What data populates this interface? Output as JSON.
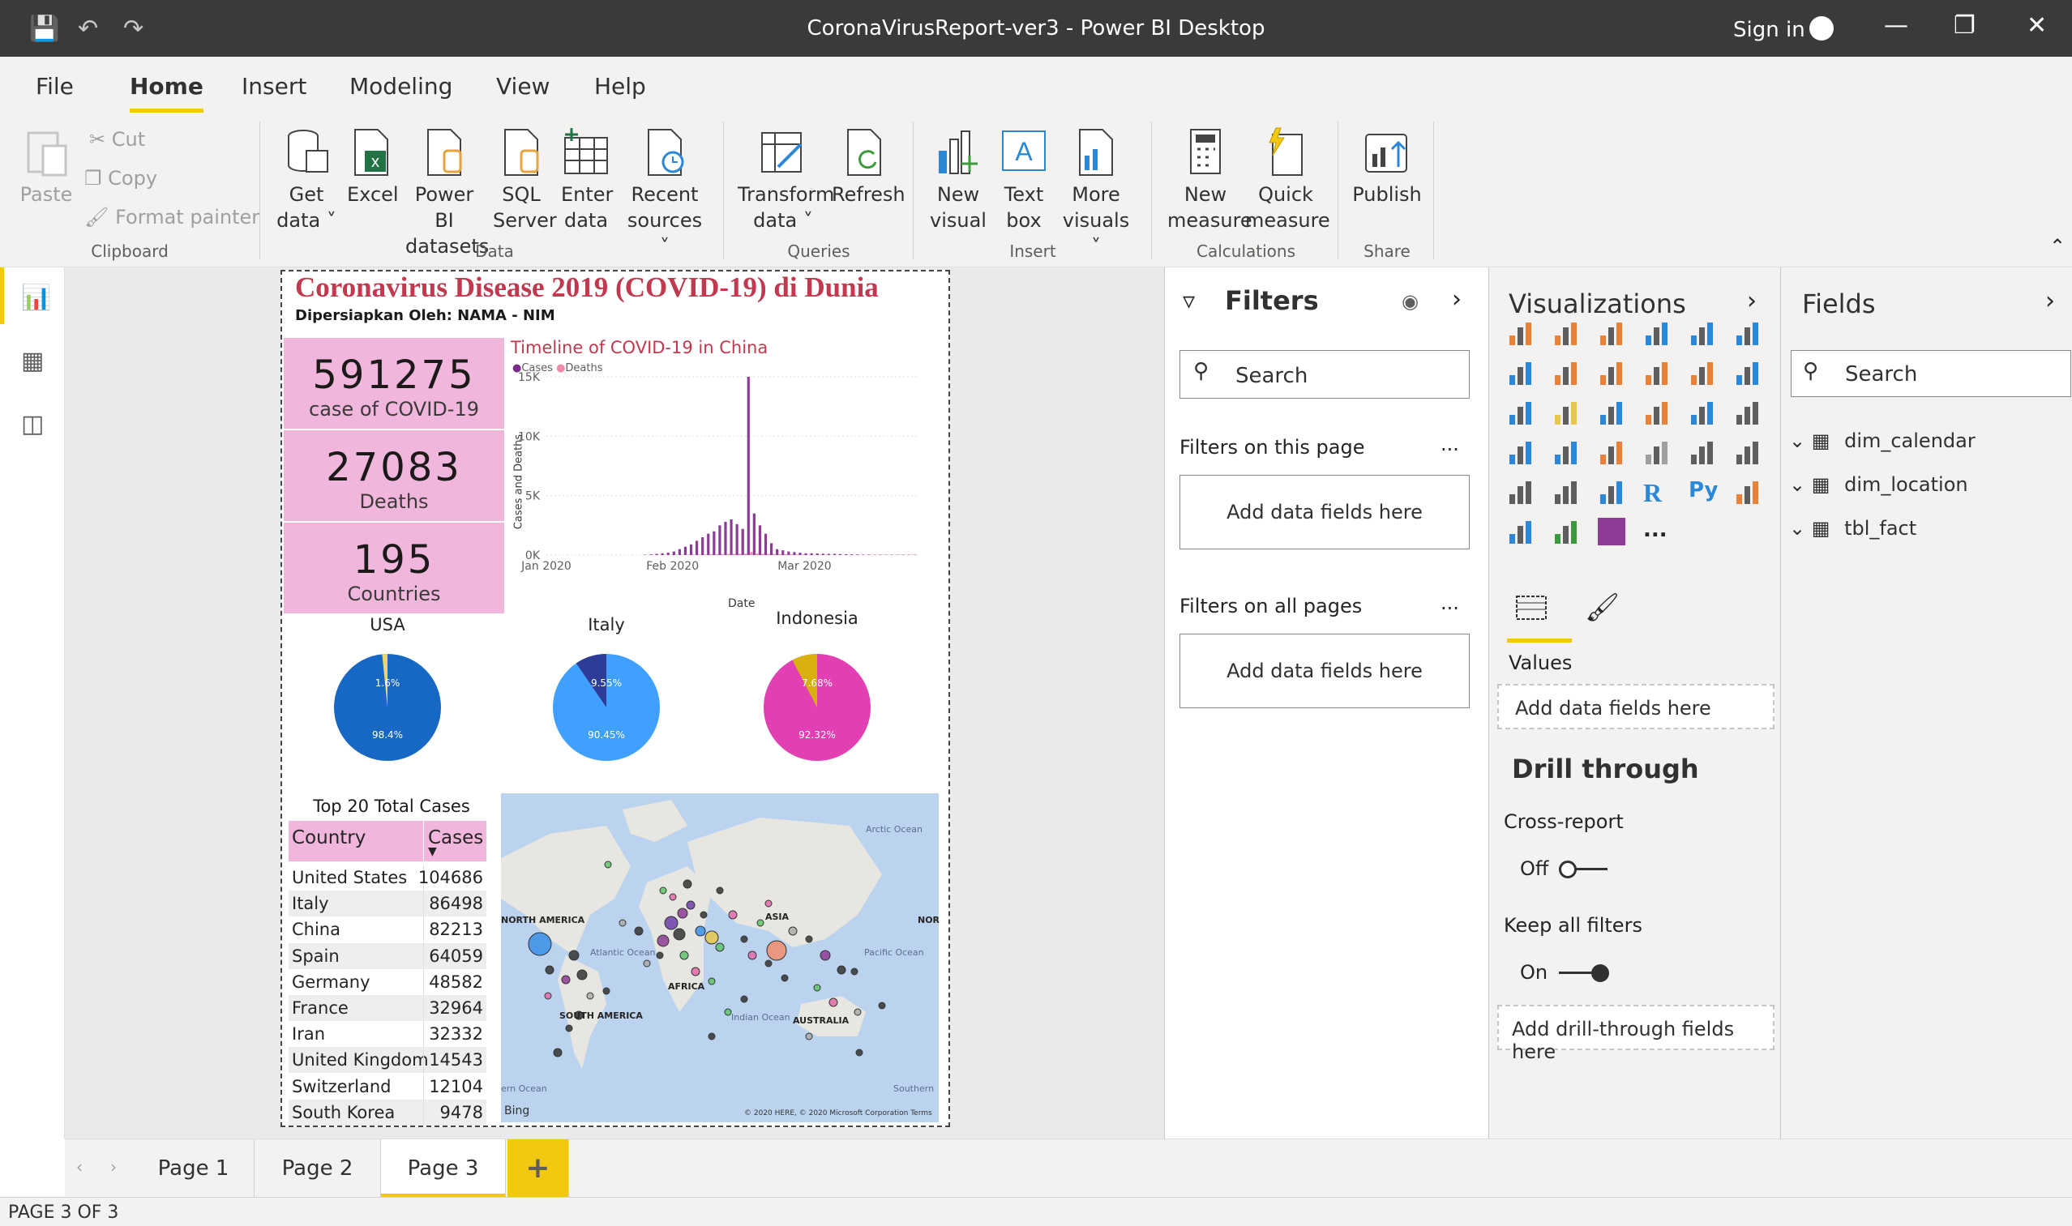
{
  "app": {
    "title": "CoronaVirusReport-ver3 - Power BI Desktop",
    "sign_in": "Sign in"
  },
  "menu": {
    "tabs": [
      "File",
      "Home",
      "Insert",
      "Modeling",
      "View",
      "Help"
    ]
  },
  "ribbon": {
    "clipboard": {
      "paste": "Paste",
      "cut": "Cut",
      "copy": "Copy",
      "format_painter": "Format painter",
      "group": "Clipboard"
    },
    "data": {
      "get_data_1": "Get",
      "get_data_2": "data",
      "excel": "Excel",
      "pbi_1": "Power BI",
      "pbi_2": "datasets",
      "sql_1": "SQL",
      "sql_2": "Server",
      "enter_1": "Enter",
      "enter_2": "data",
      "recent_1": "Recent",
      "recent_2": "sources",
      "group": "Data"
    },
    "queries": {
      "transform_1": "Transform",
      "transform_2": "data",
      "refresh": "Refresh",
      "group": "Queries"
    },
    "insert": {
      "new_visual_1": "New",
      "new_visual_2": "visual",
      "text_box_1": "Text",
      "text_box_2": "box",
      "more_1": "More",
      "more_2": "visuals",
      "group": "Insert"
    },
    "calculations": {
      "new_measure_1": "New",
      "new_measure_2": "measure",
      "quick_1": "Quick",
      "quick_2": "measure",
      "group": "Calculations"
    },
    "share": {
      "publish": "Publish",
      "group": "Share"
    }
  },
  "report": {
    "title": "Coronavirus Disease 2019 (COVID-19) di Dunia",
    "subtitle": "Dipersiapkan Oleh: NAMA - NIM",
    "kpis": [
      {
        "value": "591275",
        "label": "case of COVID-19"
      },
      {
        "value": "27083",
        "label": "Deaths"
      },
      {
        "value": "195",
        "label": "Countries"
      }
    ],
    "timeline": {
      "title": "Timeline of COVID-19 in China",
      "legend_cases": "Cases",
      "legend_deaths": "Deaths",
      "ylabel": "Cases and Deaths",
      "xlabel": "Date",
      "yticks": [
        "15K",
        "10K",
        "5K",
        "0K"
      ],
      "xticks": [
        "Jan 2020",
        "Feb 2020",
        "Mar 2020"
      ]
    },
    "pies": [
      {
        "name": "USA",
        "a": "1.6%",
        "b": "98.4%",
        "share": 1.6,
        "color_main": "#1767c4",
        "color_slice": "#e8d86a"
      },
      {
        "name": "Italy",
        "a": "9.55%",
        "b": "90.45%",
        "share": 9.55,
        "color_main": "#3fa0ff",
        "color_slice": "#2f3c97"
      },
      {
        "name": "Indonesia",
        "a": "7.68%",
        "b": "92.32%",
        "share": 7.68,
        "color_main": "#e13fb2",
        "color_slice": "#d9b00f"
      }
    ],
    "table": {
      "title": "Top 20 Total Cases",
      "col1": "Country",
      "col2": "Cases",
      "rows": [
        [
          "United States",
          "104686"
        ],
        [
          "Italy",
          "86498"
        ],
        [
          "China",
          "82213"
        ],
        [
          "Spain",
          "64059"
        ],
        [
          "Germany",
          "48582"
        ],
        [
          "France",
          "32964"
        ],
        [
          "Iran",
          "32332"
        ],
        [
          "United Kingdom",
          "14543"
        ],
        [
          "Switzerland",
          "12104"
        ],
        [
          "South Korea",
          "9478"
        ]
      ]
    },
    "map": {
      "labels": [
        "NORTH AMERICA",
        "SOUTH AMERICA",
        "AFRICA",
        "ASIA",
        "AUSTRALIA",
        "Atlantic Ocean",
        "Pacific Ocean",
        "Indian Ocean",
        "Arctic Ocean",
        "Southern",
        "ern Ocean",
        "NOR"
      ],
      "brand": "Bing",
      "copyright": "© 2020 HERE, © 2020 Microsoft Corporation Terms"
    }
  },
  "filters": {
    "title": "Filters",
    "search_placeholder": "Search",
    "on_page": "Filters on this page",
    "on_all": "Filters on all pages",
    "add": "Add data fields here",
    "more": "..."
  },
  "visualizations": {
    "title": "Visualizations",
    "values": "Values",
    "add_values": "Add data fields here",
    "drill": "Drill through",
    "cross": "Cross-report",
    "off": "Off",
    "keep": "Keep all filters",
    "on": "On",
    "add_drill": "Add drill-through fields here",
    "r": "R",
    "py": "Py",
    "more": "..."
  },
  "fields": {
    "title": "Fields",
    "search_placeholder": "Search",
    "tables": [
      "dim_calendar",
      "dim_location",
      "tbl_fact"
    ]
  },
  "pages": {
    "tabs": [
      "Page 1",
      "Page 2",
      "Page 3"
    ],
    "add": "+"
  },
  "status": "PAGE 3 OF 3",
  "chart_data": {
    "type": "bar",
    "title": "Timeline of COVID-19 in China",
    "xlabel": "Date",
    "ylabel": "Cases and Deaths",
    "ylim": [
      0,
      15000
    ],
    "x": [
      "Jan 2020",
      "",
      "",
      "",
      "",
      "",
      "",
      "",
      "",
      "",
      "",
      "",
      "",
      "",
      "",
      "",
      "",
      "",
      "",
      "",
      "",
      "",
      "Feb 2020",
      "",
      "",
      "",
      "",
      "",
      "",
      "",
      "",
      "",
      "",
      "",
      "",
      "",
      "",
      "",
      "",
      "",
      "",
      "",
      "",
      "",
      "",
      "",
      "",
      "Mar 2020",
      "",
      "",
      "",
      "",
      "",
      "",
      "",
      "",
      "",
      "",
      "",
      "",
      "",
      "",
      "",
      ""
    ],
    "series": [
      {
        "name": "Cases",
        "values": [
          0,
          0,
          0,
          0,
          0,
          0,
          0,
          0,
          0,
          0,
          0,
          0,
          0,
          0,
          0,
          0,
          0,
          30,
          60,
          100,
          150,
          200,
          300,
          500,
          700,
          900,
          1200,
          1500,
          1800,
          2000,
          2500,
          2800,
          3000,
          2600,
          2200,
          15000,
          3500,
          2500,
          1800,
          1000,
          500,
          400,
          300,
          250,
          200,
          150,
          150,
          130,
          110,
          100,
          100,
          80,
          70,
          60,
          50,
          40,
          40,
          30,
          30,
          30,
          30,
          30,
          30,
          30,
          30
        ]
      },
      {
        "name": "Deaths",
        "values": [
          0,
          0,
          0,
          0,
          0,
          0,
          0,
          0,
          0,
          0,
          0,
          0,
          0,
          0,
          0,
          0,
          0,
          2,
          4,
          6,
          8,
          10,
          15,
          20,
          25,
          30,
          40,
          50,
          60,
          70,
          80,
          90,
          100,
          110,
          120,
          250,
          130,
          110,
          100,
          90,
          80,
          70,
          60,
          50,
          40,
          30,
          30,
          30,
          25,
          20,
          20,
          15,
          15,
          10,
          10,
          10,
          8,
          8,
          6,
          6,
          6,
          5,
          5,
          5,
          5
        ]
      }
    ]
  }
}
